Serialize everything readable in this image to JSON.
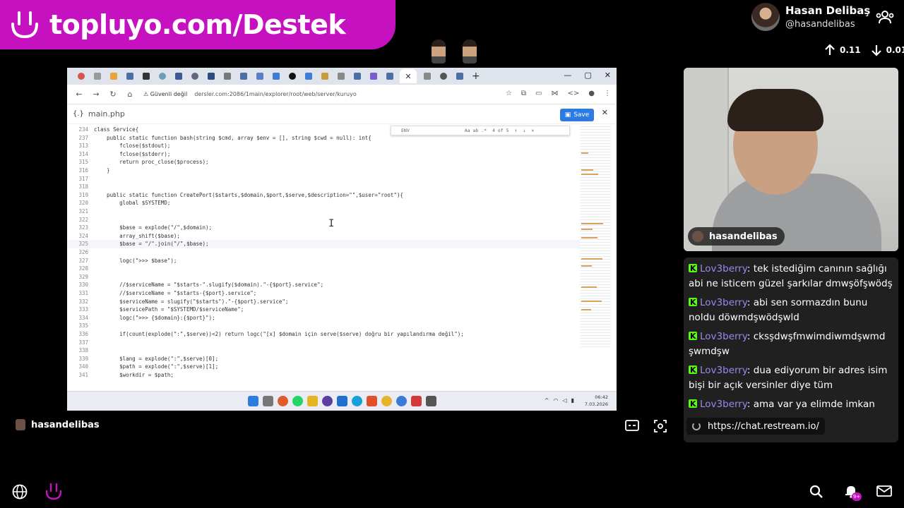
{
  "banner": {
    "text": "topluyo.com/Destek"
  },
  "profile": {
    "name": "Hasan Delibaş",
    "handle": "@hasandelibas"
  },
  "stats": {
    "up": "0.11",
    "down": "0.01"
  },
  "browser": {
    "security_label": "Güvenli değil",
    "url": "dersler.com:2086/1main/explorer/root/web/server/kuruyo",
    "file_name": "main.php",
    "save_label": "Save",
    "find": {
      "query": "ENV",
      "options": "Aa  ab  .*",
      "count": "4 of 5"
    },
    "code_lines": [
      {
        "n": "234",
        "t": "class Service{"
      },
      {
        "n": "237",
        "t": "    public static function bash(string $cmd, array $env = [], string $cwd = null): int{"
      },
      {
        "n": "313",
        "t": "        fclose($stdout);"
      },
      {
        "n": "314",
        "t": "        fclose($stderr);"
      },
      {
        "n": "315",
        "t": "        return proc_close($process);"
      },
      {
        "n": "316",
        "t": "    }"
      },
      {
        "n": "317",
        "t": ""
      },
      {
        "n": "318",
        "t": ""
      },
      {
        "n": "319",
        "t": "    public static function CreatePort($starts,$domain,$port,$serve,$description=\"\",$user=\"root\"){"
      },
      {
        "n": "320",
        "t": "        global $SYSTEMD;"
      },
      {
        "n": "321",
        "t": ""
      },
      {
        "n": "322",
        "t": ""
      },
      {
        "n": "323",
        "t": "        $base = explode(\"/\",$domain);"
      },
      {
        "n": "324",
        "t": "        array_shift($base);"
      },
      {
        "n": "325",
        "t": "        $base = \"/\".join(\"/\",$base);"
      },
      {
        "n": "326",
        "t": ""
      },
      {
        "n": "327",
        "t": "        logc(\">>> $base\");"
      },
      {
        "n": "328",
        "t": ""
      },
      {
        "n": "329",
        "t": ""
      },
      {
        "n": "330",
        "t": "        //$serviceName = \"$starts-\".slugify($domain).\"-{$port}.service\";"
      },
      {
        "n": "331",
        "t": "        //$serviceName = \"$starts-{$port}.service\";"
      },
      {
        "n": "332",
        "t": "        $serviceName = slugify(\"$starts\").\"-{$port}.service\";"
      },
      {
        "n": "333",
        "t": "        $servicePath = \"$SYSTEMD/$serviceName\";"
      },
      {
        "n": "334",
        "t": "        logc(\">>> {$domain}:{$port}\");"
      },
      {
        "n": "335",
        "t": ""
      },
      {
        "n": "336",
        "t": "        if(count(explode(\":\",$serve))<2) return logc(\"[x] $domain için serve($serve) doğru bir yapılandırma değil\");"
      },
      {
        "n": "337",
        "t": ""
      },
      {
        "n": "338",
        "t": ""
      },
      {
        "n": "339",
        "t": "        $lang = explode(\":\",$serve)[0];"
      },
      {
        "n": "340",
        "t": "        $path = explode(\":\",$serve)[1];"
      },
      {
        "n": "341",
        "t": "        $workdir = $path;"
      }
    ],
    "clock": {
      "time": "06:42",
      "date": "7.03.2026"
    }
  },
  "webcam": {
    "label": "hasandelibas"
  },
  "chat": {
    "messages": [
      {
        "user": "Lov3berry",
        "text": "tek istediğim canının sağlığı abi ne isticem güzel şarkılar dmwşöfşwödş"
      },
      {
        "user": "Lov3berry",
        "text": "abi sen sormazdın bunu noldu döwmdşwödşwld"
      },
      {
        "user": "Lov3berry",
        "text": "cksşdwşfmwimdiwmdşwmd şwmdşw"
      },
      {
        "user": "Lov3berry",
        "text": "dua ediyorum bir adres isim bişi bir açık versinler diye tüm"
      },
      {
        "user": "Lov3berry",
        "text": "ama var ya elimde imkan"
      }
    ],
    "tooltip": "https://chat.restream.io/"
  },
  "streamer": {
    "name": "hasandelibas"
  },
  "notifications": {
    "badge": "9+"
  },
  "colors": {
    "brand": "#c511bf",
    "kick": "#53fc18",
    "chat_user": "#9d86f0",
    "save": "#2c7be5"
  }
}
